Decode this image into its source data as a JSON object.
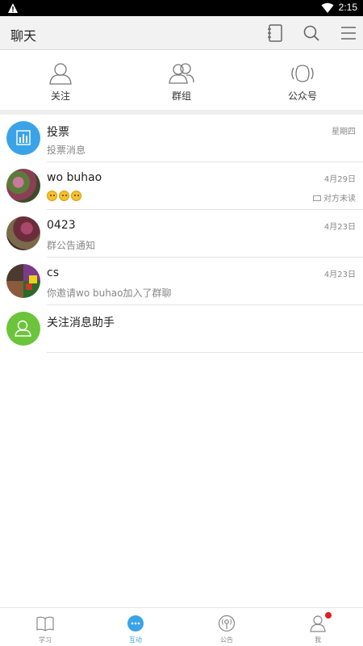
{
  "status_bar": {
    "time": "2:15"
  },
  "header": {
    "title": "聊天"
  },
  "top_nav": [
    {
      "label": "关注",
      "icon": "person-icon"
    },
    {
      "label": "群组",
      "icon": "group-icon"
    },
    {
      "label": "公众号",
      "icon": "broadcast-icon"
    }
  ],
  "chats": [
    {
      "name": "投票",
      "preview": "投票消息",
      "date": "星期四",
      "avatar": "chart-avatar"
    },
    {
      "name": "wo buhao",
      "preview": "",
      "emoji_count": 3,
      "date": "4月29日",
      "unread_label": "对方未读",
      "avatar": "flower-photo"
    },
    {
      "name": "0423",
      "preview": "群公告通知",
      "date": "4月23日",
      "avatar": "flower-photo"
    },
    {
      "name": "cs",
      "preview": "你邀请wo buhao加入了群聊",
      "date": "4月23日",
      "avatar": "mosaic-photo"
    },
    {
      "name": "关注消息助手",
      "preview": "",
      "date": "",
      "avatar": "assistant-avatar"
    }
  ],
  "tabs": [
    {
      "label": "学习",
      "icon": "book-icon"
    },
    {
      "label": "互动",
      "icon": "chat-bubble-icon",
      "active": true
    },
    {
      "label": "公告",
      "icon": "broadcast-icon"
    },
    {
      "label": "我",
      "icon": "person-icon",
      "badge": true
    }
  ],
  "colors": {
    "accent": "#3aa3e8",
    "vote_avatar": "#3aa3e8",
    "assistant_avatar": "#6cc43a",
    "badge": "#e51c23"
  }
}
